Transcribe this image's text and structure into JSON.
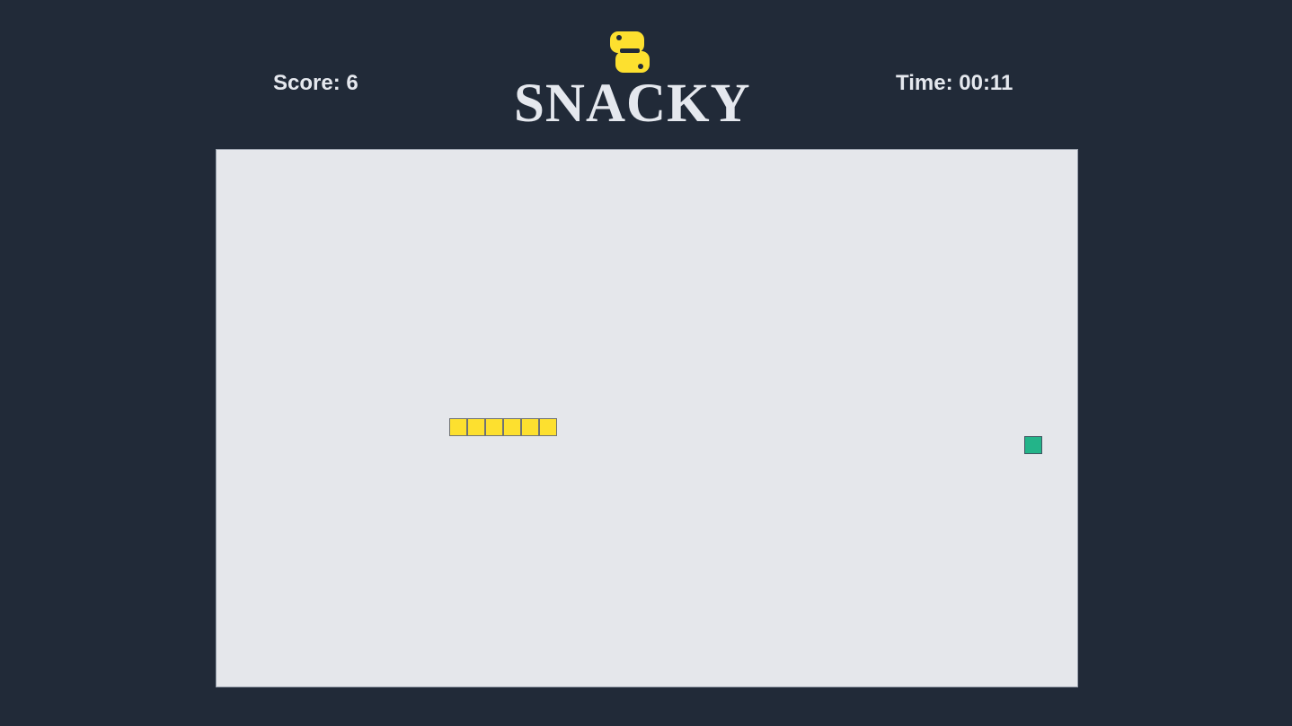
{
  "header": {
    "score_text": "Score: 6",
    "time_text": "Time: 00:11",
    "title": "SNACKY",
    "logo_icon": "python-logo-icon"
  },
  "game": {
    "grid_cols": 48,
    "grid_rows": 30,
    "snake": [
      [
        13,
        15
      ],
      [
        14,
        15
      ],
      [
        15,
        15
      ],
      [
        16,
        15
      ],
      [
        17,
        15
      ],
      [
        18,
        15
      ]
    ],
    "food": [
      45,
      16
    ]
  },
  "colors": {
    "background": "#212a38",
    "text": "#e5e8ee",
    "board": "#e5e7eb",
    "snake": "#fde02f",
    "food": "#23b489",
    "logo": "#fde02f"
  }
}
